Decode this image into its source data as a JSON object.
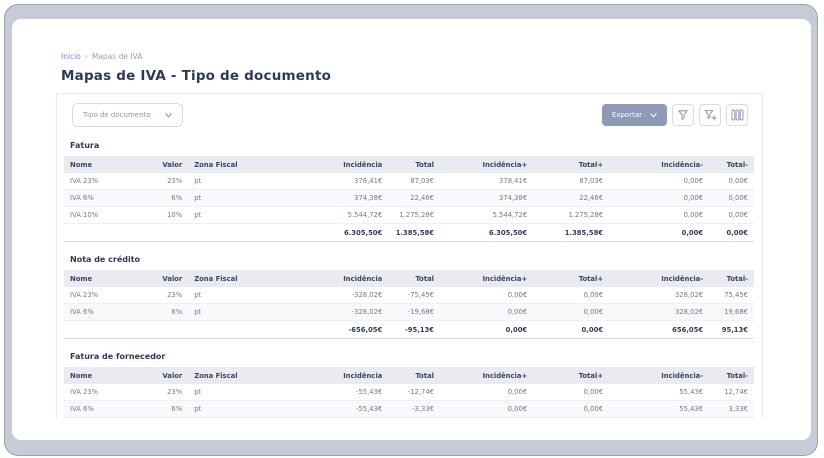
{
  "breadcrumb": {
    "home": "Início",
    "separator": "›",
    "current": "Mapas de IVA"
  },
  "page": {
    "title": "Mapas de IVA - Tipo de documento"
  },
  "toolbar": {
    "filter_dropdown": {
      "value": "Tipo de documento"
    },
    "export_button": {
      "label": "Exportar"
    }
  },
  "table": {
    "columns": [
      "Nome",
      "Valor",
      "Zona Fiscal",
      "Incidência",
      "Total",
      "Incidência+",
      "Total+",
      "Incidência-",
      "Total-"
    ]
  },
  "sections": [
    {
      "title": "Fatura",
      "rows": [
        [
          "IVA 23%",
          "23%",
          "pt",
          "378,41€",
          "87,03€",
          "378,41€",
          "87,03€",
          "0,00€",
          "0,00€"
        ],
        [
          "IVA 6%",
          "6%",
          "pt",
          "374,38€",
          "22,46€",
          "374,38€",
          "22,46€",
          "0,00€",
          "0,00€"
        ],
        [
          "IVA 10%",
          "10%",
          "pt",
          "5.544,72€",
          "1.275,28€",
          "5.544,72€",
          "1.275,28€",
          "0,00€",
          "0,00€"
        ]
      ],
      "totals": [
        "6.305,50€",
        "1.385,58€",
        "6.305,50€",
        "1.385,58€",
        "0,00€",
        "0,00€"
      ]
    },
    {
      "title": "Nota de crédito",
      "rows": [
        [
          "IVA 23%",
          "23%",
          "pt",
          "-328,02€",
          "-75,45€",
          "0,00€",
          "0,00€",
          "328,02€",
          "75,45€"
        ],
        [
          "IVA 6%",
          "6%",
          "pt",
          "-328,02€",
          "-19,68€",
          "0,00€",
          "0,00€",
          "328,02€",
          "19,68€"
        ]
      ],
      "totals": [
        "-656,05€",
        "-95,13€",
        "0,00€",
        "0,00€",
        "656,05€",
        "95,13€"
      ]
    },
    {
      "title": "Fatura de fornecedor",
      "rows": [
        [
          "IVA 23%",
          "23%",
          "pt",
          "-55,43€",
          "-12,74€",
          "0,00€",
          "0,00€",
          "55,43€",
          "12,74€"
        ],
        [
          "IVA 6%",
          "6%",
          "pt",
          "-55,43€",
          "-3,33€",
          "0,00€",
          "0,00€",
          "55,43€",
          "3,33€"
        ]
      ],
      "totals": null
    }
  ],
  "colors": {
    "frame": "#c6cbd5",
    "breadcrumb_link": "#7b7ff2",
    "title_text": "#2e3a59",
    "export_button_bg": "#8d9ab6",
    "table_header_bg": "#e9ebf1"
  }
}
